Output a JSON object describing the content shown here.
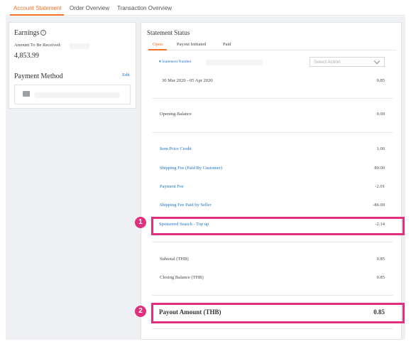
{
  "tabs": [
    {
      "label": "Account Statement",
      "active": true
    },
    {
      "label": "Order Overview",
      "active": false
    },
    {
      "label": "Transaction Overview",
      "active": false
    }
  ],
  "earnings": {
    "title": "Earnings",
    "amount_label": "Amount To Be Received:",
    "amount": "4,853.99",
    "payment_method_label": "Payment Method",
    "edit_label": "Edit"
  },
  "statement": {
    "title": "Statement Status",
    "subtabs": [
      "Open",
      "Payout Initiated",
      "Paid"
    ],
    "statement_number_label": "Statement Number",
    "select_placeholder": "Select Action",
    "period": "30 Mar 2020 - 05 Apr 2020",
    "period_value": "0.85",
    "opening_balance_label": "Opening Balance",
    "opening_balance_value": "0.00",
    "items": [
      {
        "label": "Item Price Credit",
        "value": "1.00"
      },
      {
        "label": "Shipping Fee (Paid By Customer)",
        "value": "89.00"
      },
      {
        "label": "Payment Fee",
        "value": "-2.01"
      },
      {
        "label": "Shipping Fee Paid by Seller",
        "value": "-86.00"
      },
      {
        "label": "Sponsored Search - Top up",
        "value": "-2.14"
      }
    ],
    "subtotal_label": "Subtotal (THB)",
    "subtotal_value": "0.85",
    "closing_label": "Closing Balance (THB)",
    "closing_value": "0.85",
    "payout_label": "Payout Amount (THB)",
    "payout_value": "0.85"
  },
  "annotations": {
    "badge1": "1",
    "badge2": "2",
    "color": "#e0307d"
  },
  "colors": {
    "accent": "#f57224",
    "link": "#1a73c9"
  }
}
